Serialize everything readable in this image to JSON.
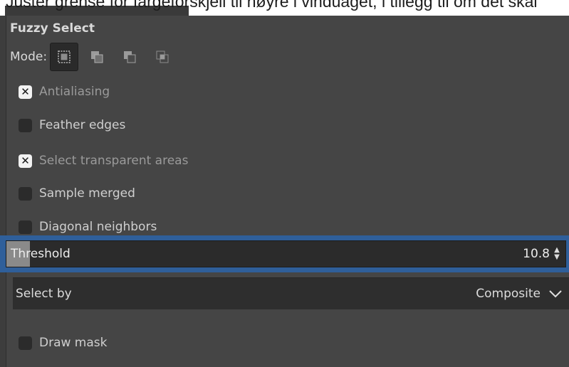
{
  "page": {
    "top_text": "Juster grense for fargeforskjell til høyre i vinduaget, i tillegg til om det skal"
  },
  "tool": {
    "title": "Fuzzy Select",
    "mode_label": "Mode:",
    "mode_icons": [
      "mode-replace-icon",
      "mode-add-icon",
      "mode-subtract-icon",
      "mode-intersect-icon"
    ],
    "active_mode_index": 0
  },
  "options": {
    "antialiasing": {
      "label": "Antialiasing",
      "checked": true
    },
    "feather_edges": {
      "label": "Feather edges",
      "checked": false
    },
    "select_transparent": {
      "label": "Select transparent areas",
      "checked": true
    },
    "sample_merged": {
      "label": "Sample merged",
      "checked": false
    },
    "diagonal_neighbors": {
      "label": "Diagonal neighbors",
      "checked": false
    },
    "draw_mask": {
      "label": "Draw mask",
      "checked": false
    }
  },
  "threshold": {
    "label": "Threshold",
    "value": "10.8",
    "fill_fraction": 0.042
  },
  "select_by": {
    "label": "Select by",
    "value": "Composite"
  },
  "colors": {
    "focus_border": "#2f5f9a",
    "panel_bg": "#454545",
    "field_bg": "#2b2b2b"
  }
}
